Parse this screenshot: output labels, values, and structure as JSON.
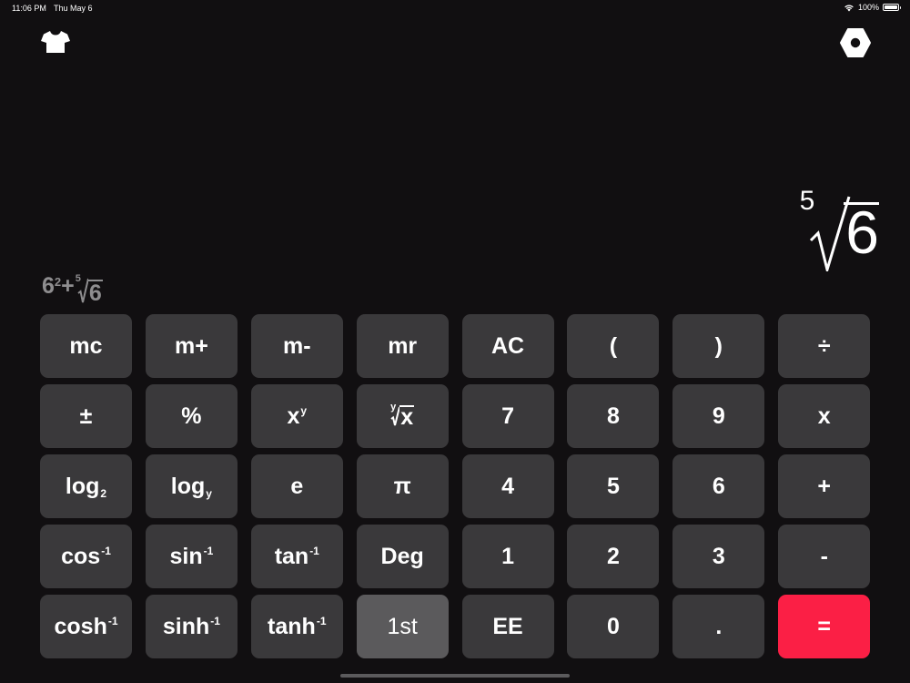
{
  "status": {
    "time": "11:06 PM",
    "date": "Thu May 6",
    "battery": "100%",
    "battery_level": 1.0
  },
  "icons": {
    "left": "tshirt-icon",
    "right": "hexagon-gear-icon",
    "wifi": "wifi-icon",
    "battery": "battery-icon"
  },
  "display": {
    "index": "5",
    "radicand": "6"
  },
  "expression": {
    "base": "6",
    "exponent": "2",
    "operator": "+",
    "root_index": "5",
    "radicand": "6"
  },
  "keys": {
    "mc": "mc",
    "m_plus": "m+",
    "m_minus": "m-",
    "mr": "mr",
    "ac": "AC",
    "open_paren": "(",
    "close_paren": ")",
    "divide": "÷",
    "plus_minus": "±",
    "percent": "%",
    "x_pow_base": "x",
    "x_pow_sup": "y",
    "yroot_index": "y",
    "yroot_radicand": "x",
    "seven": "7",
    "eight": "8",
    "nine": "9",
    "multiply": "x",
    "log2_base": "log",
    "log2_sub": "2",
    "logy_base": "log",
    "logy_sub": "y",
    "e": "e",
    "pi": "π",
    "four": "4",
    "five": "5",
    "six": "6",
    "plus": "+",
    "acos_base": "cos",
    "asin_base": "sin",
    "atan_base": "tan",
    "inv_sup": "-1",
    "deg": "Deg",
    "one": "1",
    "two": "2",
    "three": "3",
    "minus": "-",
    "acosh_base": "cosh",
    "asinh_base": "sinh",
    "atanh_base": "tanh",
    "first": "1st",
    "ee": "EE",
    "zero": "0",
    "decimal": ".",
    "equals": "="
  },
  "colors": {
    "background": "#110f11",
    "key": "#3a393b",
    "key_active": "#5b5a5c",
    "equals": "#fb1f45",
    "expression_text": "#8e8d8f"
  }
}
